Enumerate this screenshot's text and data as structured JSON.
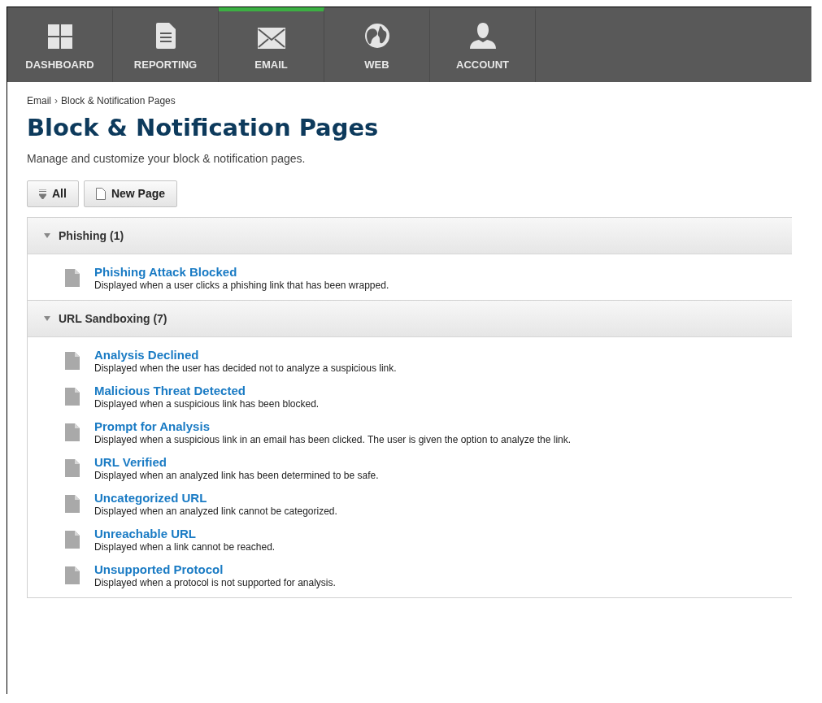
{
  "nav": {
    "tabs": [
      {
        "label": "DASHBOARD",
        "kind": "grid",
        "selected": false
      },
      {
        "label": "REPORTING",
        "kind": "document",
        "selected": false
      },
      {
        "label": "EMAIL",
        "kind": "envelope",
        "selected": true
      },
      {
        "label": "WEB",
        "kind": "globe",
        "selected": false
      },
      {
        "label": "ACCOUNT",
        "kind": "person",
        "selected": false
      }
    ]
  },
  "breadcrumb": {
    "items": [
      "Email",
      "Block & Notification Pages"
    ],
    "separator": "›"
  },
  "title": "Block & Notification Pages",
  "subtitle": "Manage and customize your block & notification pages.",
  "toolbar": {
    "buttons": [
      {
        "label": "All",
        "kind": "collapse"
      },
      {
        "label": "New Page",
        "kind": "new"
      }
    ]
  },
  "sections": [
    {
      "title": "Phishing (1)",
      "expanded": true,
      "items": [
        {
          "title": "Phishing Attack Blocked",
          "description": "Displayed when a user clicks a phishing link that has been wrapped."
        }
      ]
    },
    {
      "title": "URL Sandboxing (7)",
      "expanded": true,
      "items": [
        {
          "title": "Analysis Declined",
          "description": "Displayed when the user has decided not to analyze a suspicious link."
        },
        {
          "title": "Malicious Threat Detected",
          "description": "Displayed when a suspicious link has been blocked."
        },
        {
          "title": "Prompt for Analysis",
          "description": "Displayed when a suspicious link in an email has been clicked. The user is given the option to analyze the link."
        },
        {
          "title": "URL Verified",
          "description": "Displayed when an analyzed link has been determined to be safe."
        },
        {
          "title": "Uncategorized URL",
          "description": "Displayed when an analyzed link cannot be categorized."
        },
        {
          "title": "Unreachable URL",
          "description": "Displayed when a link cannot be reached."
        },
        {
          "title": "Unsupported Protocol",
          "description": "Displayed when a protocol is not supported for analysis."
        }
      ]
    }
  ]
}
